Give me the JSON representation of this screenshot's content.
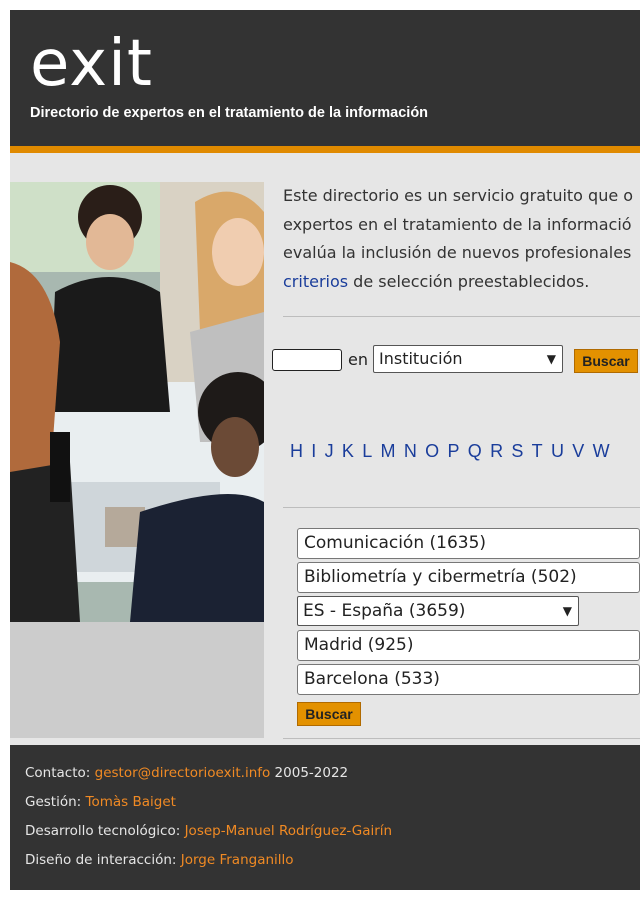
{
  "header": {
    "logo": "exit",
    "tagline": "Directorio de expertos en el tratamiento de la información"
  },
  "intro": {
    "line1": "Este directorio es un servicio gratuito que o",
    "line2": "expertos en el tratamiento de la informació",
    "line3": "evalúa la inclusión de nuevos profesionales",
    "link": "criterios",
    "line4_rest": " de selección preestablecidos."
  },
  "search": {
    "input_value": "",
    "en_label": "en",
    "field_selected": "Institución",
    "button": "Buscar"
  },
  "alphabet": [
    "H",
    "I",
    "J",
    "K",
    "L",
    "M",
    "N",
    "O",
    "P",
    "Q",
    "R",
    "S",
    "T",
    "U",
    "V",
    "W"
  ],
  "filters": {
    "topic": "Comunicación (1635)",
    "subtopic": "Bibliometría y cibermetría (502)",
    "country": "ES - España (3659)",
    "city1": "Madrid (925)",
    "city2": "Barcelona (533)",
    "button": "Buscar"
  },
  "footer": {
    "contact_label": "Contacto: ",
    "contact_email": "gestor@directorioexit.info",
    "contact_years": " 2005-2022",
    "management_label": "Gestión: ",
    "management_name": "Tomàs Baiget",
    "dev_label": "Desarrollo tecnológico: ",
    "dev_name": "Josep-Manuel Rodríguez-Gairín",
    "design_label": "Diseño de interacción: ",
    "design_name": "Jorge Franganillo"
  },
  "colors": {
    "header_bg": "#333333",
    "accent_orange": "#e08a00",
    "link_blue": "#1a3d9b",
    "footer_link": "#f08a24"
  }
}
